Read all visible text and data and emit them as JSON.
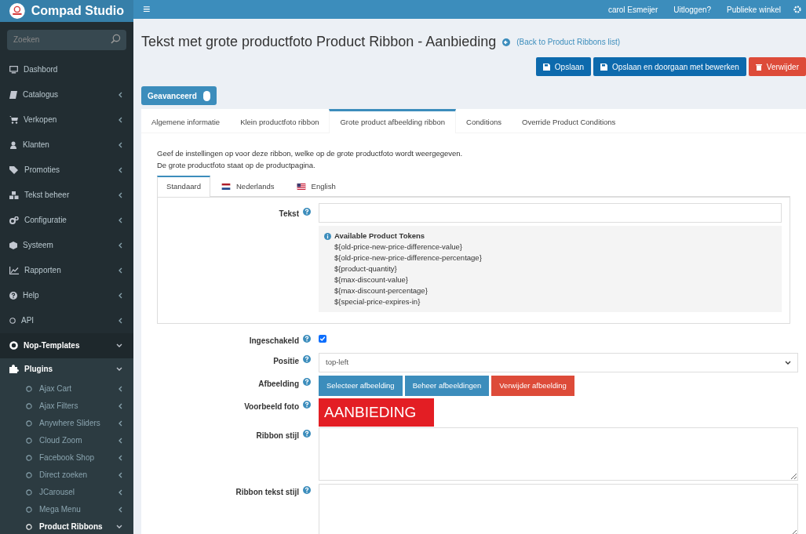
{
  "brand": {
    "name": "Compad Studio"
  },
  "header": {
    "menu_glyph": "≡",
    "links": [
      "carol Esmeijer",
      "Uitloggen?",
      "Publieke winkel"
    ]
  },
  "sidebar": {
    "search": {
      "placeholder": "Zoeken"
    },
    "items": [
      {
        "label": "Dashbord"
      },
      {
        "label": "Catalogus",
        "expanded": false
      },
      {
        "label": "Verkopen",
        "expanded": false
      },
      {
        "label": "Klanten",
        "expanded": false
      },
      {
        "label": "Promoties",
        "expanded": false
      },
      {
        "label": "Tekst beheer",
        "expanded": false
      },
      {
        "label": "Configuratie",
        "expanded": false
      },
      {
        "label": "Systeem",
        "expanded": false
      },
      {
        "label": "Rapporten",
        "expanded": false
      },
      {
        "label": "Help",
        "expanded": false
      },
      {
        "label": "API",
        "expanded": false
      },
      {
        "label": "Nop-Templates",
        "expanded": true
      },
      {
        "label": "Plugins",
        "expanded": true,
        "children": [
          {
            "label": "Ajax Cart",
            "expanded": false,
            "selected": false
          },
          {
            "label": "Ajax Filters",
            "expanded": false,
            "selected": false
          },
          {
            "label": "Anywhere Sliders",
            "expanded": false,
            "selected": false
          },
          {
            "label": "Cloud Zoom",
            "expanded": false,
            "selected": false
          },
          {
            "label": "Facebook Shop",
            "expanded": false,
            "selected": false
          },
          {
            "label": "Direct zoeken",
            "expanded": false,
            "selected": false
          },
          {
            "label": "JCarousel",
            "expanded": false,
            "selected": false
          },
          {
            "label": "Mega Menu",
            "expanded": false,
            "selected": false
          },
          {
            "label": "Product Ribbons",
            "expanded": true,
            "selected": true
          }
        ]
      }
    ]
  },
  "page": {
    "title": "Tekst met grote productfoto Product Ribbon - Aanbieding",
    "back_link": "(Back to Product Ribbons list)",
    "actions": [
      {
        "label": "Opslaan",
        "kind": "primary"
      },
      {
        "label": "Opslaan en doorgaan met bewerken",
        "kind": "primary"
      },
      {
        "label": "Verwijder",
        "kind": "danger"
      }
    ],
    "advanced_toggle": {
      "label": "Geavanceerd",
      "on": true
    },
    "tabs": [
      {
        "label": "Algemene informatie",
        "selected": false
      },
      {
        "label": "Klein productfoto ribbon",
        "selected": false
      },
      {
        "label": "Grote product afbeelding ribbon",
        "selected": true
      },
      {
        "label": "Conditions",
        "selected": false
      },
      {
        "label": "Override Product Conditions",
        "selected": false
      }
    ],
    "intro": [
      "Geef de instellingen op voor deze ribbon, welke op de grote productfoto wordt weergegeven.",
      "De grote productfoto staat op de productpagina."
    ],
    "language_tabs": [
      {
        "label": "Standaard",
        "selected": true
      },
      {
        "label": "Nederlands",
        "selected": false
      },
      {
        "label": "English",
        "selected": false
      }
    ],
    "text_field": {
      "label": "Tekst"
    },
    "tokens": {
      "title": "Available Product Tokens",
      "items": [
        "${old-price-new-price-difference-value}",
        "${old-price-new-price-difference-percentage}",
        "${product-quantity}",
        "${max-discount-value}",
        "${max-discount-percentage}",
        "${special-price-expires-in}"
      ]
    },
    "form": [
      {
        "kind": "checkbox",
        "label": "Ingeschakeld",
        "checked": true
      },
      {
        "kind": "select",
        "label": "Positie",
        "value": "top-left"
      },
      {
        "kind": "buttons",
        "label": "Afbeelding",
        "buttons": [
          {
            "label": "Selecteer afbeelding",
            "kind": "primary"
          },
          {
            "label": "Beheer afbeeldingen",
            "kind": "primary"
          },
          {
            "label": "Verwijder afbeelding",
            "kind": "danger"
          }
        ]
      },
      {
        "kind": "preview",
        "label": "Voorbeeld foto",
        "text": "AANBIEDING"
      },
      {
        "kind": "textarea",
        "label": "Ribbon stijl"
      },
      {
        "kind": "textarea",
        "label": "Ribbon tekst stijl"
      }
    ]
  }
}
